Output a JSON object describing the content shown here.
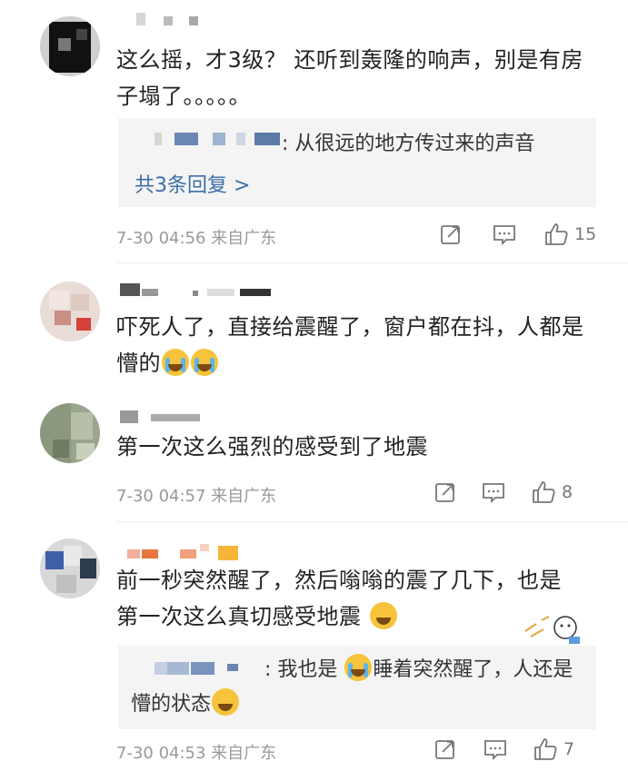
{
  "comments": [
    {
      "text": "这么摇，才3级？ 还听到轰隆的响声，别是有房子塌了。。。。。",
      "reply_preview": ": 从很远的地方传过来的声音",
      "more_replies": "共3条回复 >",
      "time": "7-30 04:56 来自广东",
      "likes": "15"
    },
    {
      "text": "吓死人了，直接给震醒了，窗户都在抖，人都是懵的"
    },
    {
      "text": "第一次这么强烈的感受到了地震",
      "time": "7-30 04:57 来自广东",
      "likes": "8"
    },
    {
      "text": "前一秒突然醒了，然后嗡嗡的震了几下，也是第一次这么真切感受地震",
      "reply_preview_a": ": 我也是",
      "reply_preview_b": "睡着突然醒了，人还是懵的状态",
      "time": "7-30 04:53 来自广东",
      "likes": "7"
    }
  ],
  "icons": {
    "share": "share-icon",
    "comment": "comment-icon",
    "like": "thumbs-up-icon",
    "cry": "crying-face-emoji",
    "laugh": "laughing-tears-emoji"
  },
  "colors": {
    "link": "#3d6ea7",
    "meta": "#999999",
    "reply_bg": "#f4f4f4"
  }
}
